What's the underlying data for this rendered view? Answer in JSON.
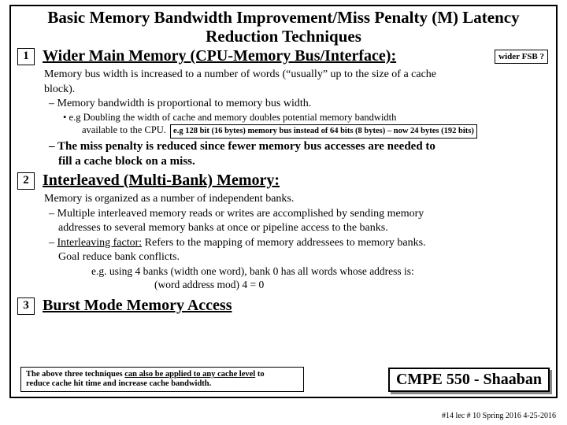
{
  "title_l1": "Basic Memory Bandwidth Improvement/Miss Penalty (M) Latency",
  "title_l2": "Reduction Techniques",
  "sec1": {
    "num": "1",
    "title": "Wider Main Memory (CPU-Memory Bus/Interface):",
    "aside": "wider FSB ?",
    "p1a": "Memory bus width is increased to a number of words  (“usually” up to the size of a cache",
    "p1b": "block).",
    "d1": "Memory bandwidth is proportional to memory bus width.",
    "b1a": "e.g  Doubling the width of cache and memory doubles potential memory bandwidth",
    "b1b_pre": "available to the CPU.",
    "b1b_box": "e.g 128 bit (16 bytes) memory bus instead of 64 bits (8 bytes) – now 24 bytes (192 bits)",
    "d2a": "The miss penalty is reduced since fewer memory bus accesses are needed to",
    "d2b": "fill a cache block on a miss."
  },
  "sec2": {
    "num": "2",
    "title": "Interleaved (Multi-Bank) Memory:",
    "p1": "Memory is organized as a number of independent banks.",
    "d1a": "Multiple interleaved memory reads or writes are accomplished by sending memory",
    "d1b": "addresses to several memory banks at once or pipeline access to the banks.",
    "d2_pre": "Interleaving factor:",
    "d2_rest": "  Refers to the mapping of memory addressees to memory banks.",
    "d2b": "Goal reduce bank conflicts.",
    "eg1": "e.g.  using 4 banks (width one word), bank 0 has all words whose address  is:",
    "eg2": "(word address mod)  4  =  0"
  },
  "sec3": {
    "num": "3",
    "title": "Burst Mode Memory Access"
  },
  "footer": {
    "l1_pre": "The above three techniques ",
    "l1_u": "can also be applied to any cache level",
    "l1_post": " to",
    "l2": "reduce cache hit time and increase cache bandwidth."
  },
  "badge": "CMPE 550 - Shaaban",
  "meta": "#14    lec # 10    Spring 2016    4-25-2016"
}
